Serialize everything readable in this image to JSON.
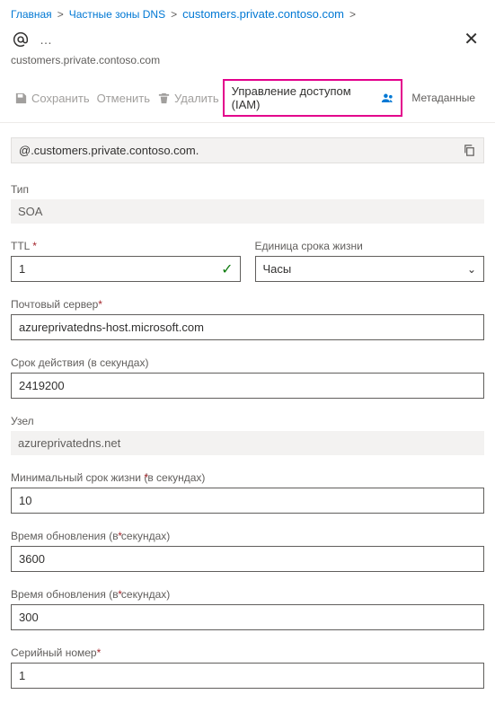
{
  "breadcrumbs": {
    "home": "Главная",
    "zones": "Частные зоны DNS",
    "current": "customers.private.contoso.com"
  },
  "header": {
    "subtitle": "customers.private.contoso.com",
    "more": "…"
  },
  "toolbar": {
    "save": "Сохранить",
    "cancel": "Отменить",
    "delete": "Удалить",
    "iam": "Управление доступом (IAM)",
    "metadata": "Метаданные"
  },
  "namebox": "@.customers.private.contoso.com.",
  "fields": {
    "type_label": "Тип",
    "type_value": "SOA",
    "ttl_label": "TTL",
    "ttl_value": "1",
    "ttl_unit_label": "Единица срока жизни",
    "ttl_unit_value": "Часы",
    "mailserver_label": "Почтовый сервер",
    "mailserver_value": "azureprivatedns-host.microsoft.com",
    "expire_label": "Срок действия (в секундах)",
    "expire_value": "2419200",
    "node_label": "Узел",
    "node_value": "azureprivatedns.net",
    "minttl_label": "Минимальный срок жизни (в секундах)",
    "minttl_value": "10",
    "refresh_label": "Время обновления (в секундах)",
    "refresh_value": "3600",
    "retry_label": "Время обновления (в секундах)",
    "retry_value": "300",
    "serial_label": "Серийный номер",
    "serial_value": "1"
  }
}
